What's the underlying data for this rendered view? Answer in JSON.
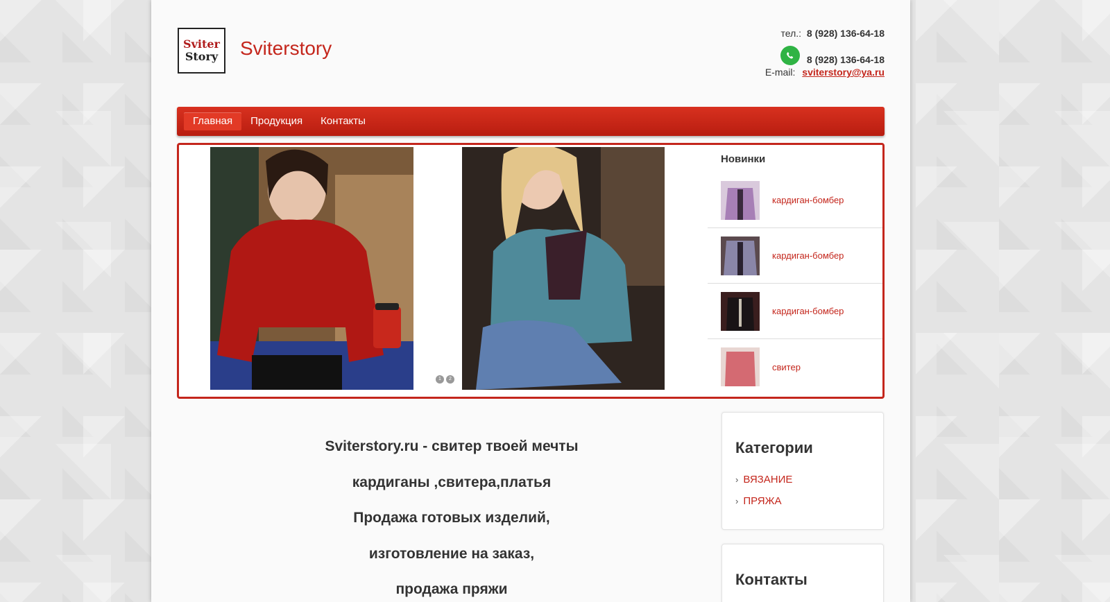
{
  "header": {
    "logo_line1": "Sviter",
    "logo_line2": "Story",
    "site_title": "Sviterstory",
    "phone_label": "тел.:",
    "phone": "8 (928) 136-64-18",
    "whatsapp_phone": "8 (928) 136-64-18",
    "email_label": "E-mail:",
    "email": "sviterstory@ya.ru"
  },
  "nav": {
    "items": [
      {
        "label": "Главная",
        "active": true
      },
      {
        "label": "Продукция",
        "active": false
      },
      {
        "label": "Контакты",
        "active": false
      }
    ]
  },
  "slider": {
    "dots": [
      "1",
      "2"
    ]
  },
  "novelties": {
    "title": "Новинки",
    "items": [
      {
        "label": "кардиган-бомбер"
      },
      {
        "label": "кардиган-бомбер"
      },
      {
        "label": "кардиган-бомбер"
      },
      {
        "label": "свитер"
      }
    ]
  },
  "main": {
    "lines": [
      "Sviterstory.ru - свитер твоей мечты",
      "кардиганы ,свитера,платья",
      "Продажа готовых изделий,",
      "изготовление на заказ,",
      "продажа пряжи"
    ]
  },
  "sidebar": {
    "categories_title": "Категории",
    "categories": [
      "ВЯЗАНИЕ",
      "ПРЯЖА"
    ],
    "contacts_title": "Контакты"
  },
  "colors": {
    "brand_red": "#c4261c",
    "whatsapp_green": "#2fb344"
  }
}
